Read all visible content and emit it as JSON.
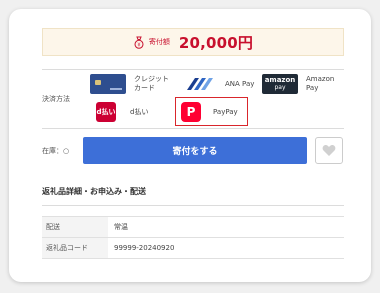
{
  "amount": {
    "label": "寄付額",
    "value": "20,000円"
  },
  "payment": {
    "label": "決済方法",
    "methods": [
      {
        "name": "クレジットカード",
        "line1": "クレジット",
        "line2": "カード",
        "icon": "credit-card-icon"
      },
      {
        "name": "ANA Pay",
        "icon": "ana-pay-icon"
      },
      {
        "name": "Amazon Pay",
        "line1": "Amazon",
        "line2": "Pay",
        "icon": "amazon-pay-icon",
        "logo_line1": "amazon",
        "logo_line2": "pay"
      },
      {
        "name": "d払い",
        "icon": "d-barai-icon",
        "logo_line1": "d払い"
      },
      {
        "name": "PayPay",
        "icon": "paypay-icon",
        "logo_text": "P",
        "selected": true
      }
    ]
  },
  "stock": {
    "label": "在庫：",
    "value": "○"
  },
  "donate_button": "寄付をする",
  "favorite_icon": "heart-icon",
  "details": {
    "title": "返礼品詳細・お申込み・配送",
    "rows": [
      {
        "key": "配送",
        "value": "常温"
      },
      {
        "key": "返礼品コード",
        "value": "99999-20240920"
      }
    ]
  },
  "colors": {
    "accent_red": "#c8102e",
    "donate_blue": "#3d6fd8",
    "selected_border": "#d9262c",
    "paypay_red": "#ff0033"
  }
}
